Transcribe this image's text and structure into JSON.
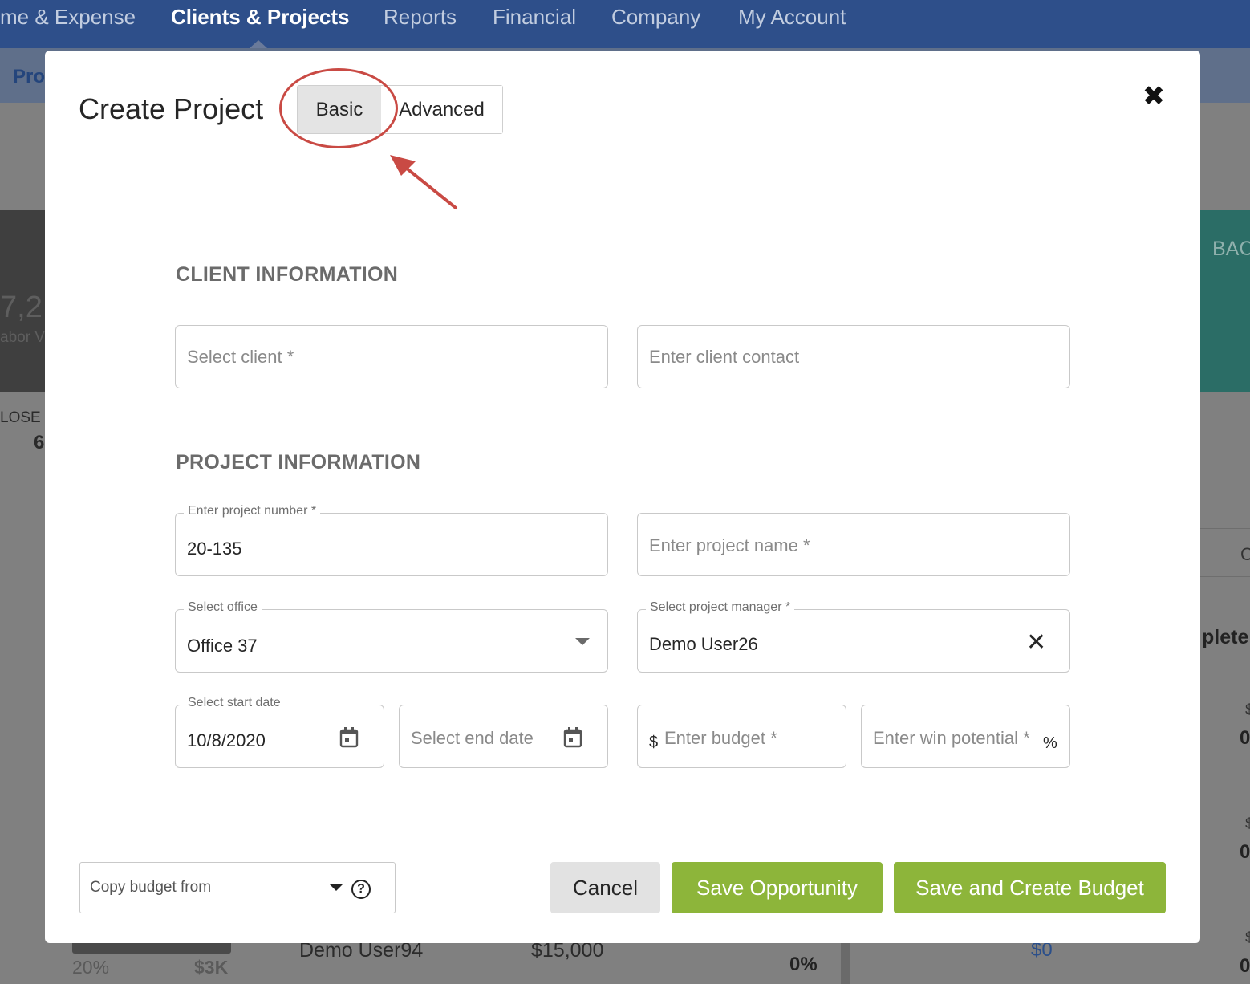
{
  "topnav": {
    "items": [
      {
        "label": "me & Expense",
        "active": false
      },
      {
        "label": "Clients & Projects",
        "active": true
      },
      {
        "label": "Reports",
        "active": false
      },
      {
        "label": "Financial",
        "active": false
      },
      {
        "label": "Company",
        "active": false
      },
      {
        "label": "My Account",
        "active": false
      }
    ]
  },
  "subbar": {
    "label": "Pro"
  },
  "background": {
    "left_value": "7,2",
    "left_caption": "abor V",
    "left_row_label": "LOSE R",
    "left_row_value": "6",
    "right_card_label": "BAC",
    "right_header_fragment": "C",
    "right_col_label": "plete",
    "right_values": [
      "$",
      "0",
      "$",
      "0",
      "$",
      "0"
    ],
    "bottom_row": {
      "percent": "20%",
      "amount": "$3K",
      "user": "Demo User94",
      "budget": "$15,000",
      "pct_top": "%",
      "pct": "0%",
      "zero_amount": "$0"
    }
  },
  "modal": {
    "title": "Create Project",
    "mode_toggle": {
      "basic": "Basic",
      "advanced": "Advanced",
      "selected": "Basic"
    },
    "client_section": {
      "title": "CLIENT INFORMATION",
      "client_placeholder": "Select client *",
      "contact_placeholder": "Enter client contact"
    },
    "project_section": {
      "title": "PROJECT INFORMATION",
      "project_number_label": "Enter project number *",
      "project_number_value": "20-135",
      "project_name_placeholder": "Enter project name *",
      "office_label": "Select office",
      "office_value": "Office 37",
      "manager_label": "Select project manager *",
      "manager_value": "Demo User26",
      "start_date_label": "Select start date",
      "start_date_value": "10/8/2020",
      "end_date_placeholder": "Select end date",
      "budget_prefix": "$",
      "budget_placeholder": "Enter budget *",
      "win_potential_placeholder": "Enter win potential *",
      "win_potential_suffix": "%"
    },
    "footer": {
      "copy_budget_placeholder": "Copy budget from",
      "help_glyph": "?",
      "cancel_label": "Cancel",
      "save_opportunity_label": "Save Opportunity",
      "save_budget_label": "Save and Create Budget"
    },
    "close_glyph": "✖",
    "clear_glyph": "✕"
  },
  "colors": {
    "nav": "#2e4f8a",
    "primary_button": "#8db53a",
    "annotation": "#c94a44"
  },
  "icons": [
    "close-icon",
    "calendar-icon",
    "chevron-down-icon",
    "help-icon",
    "clear-icon",
    "annotation-arrow"
  ]
}
